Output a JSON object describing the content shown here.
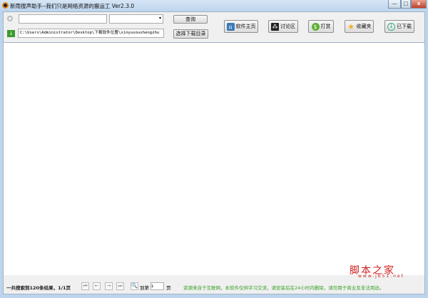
{
  "window": {
    "title": "新雨搜声助手--我们只是网络资源的搬运工 Ver2.3.0",
    "min": "—",
    "max": "□",
    "close": "x"
  },
  "search": {
    "value": "",
    "dropdown_value": "",
    "query_label": "查询"
  },
  "download": {
    "path": "C:\\Users\\Administrator\\Desktop\\下载软件位置\\xinyusoushengzhu",
    "choose_dir_label": "选择下载目录"
  },
  "toolbar": [
    {
      "label": "软件主页",
      "icon": "home-icon"
    },
    {
      "label": "讨论区",
      "icon": "people-icon"
    },
    {
      "label": "打赏",
      "icon": "dollar-icon"
    },
    {
      "label": "收藏夹",
      "icon": "star-icon"
    },
    {
      "label": "已下载",
      "icon": "download-icon"
    }
  ],
  "footer": {
    "result_text": "一共搜索到120条结果，1/1页",
    "goto_label": "到第",
    "page_value": "1",
    "page_suffix": "页",
    "notice": "资源来自于互联网，本软件仅供学习交流，请安装后在24小时内删除，请勿用于商业及非法用途。"
  },
  "watermark": {
    "text": "脚本之家",
    "url": "www.jb51.net"
  },
  "colors": {
    "notice": "#3aa02a",
    "watermark": "#d02020"
  }
}
